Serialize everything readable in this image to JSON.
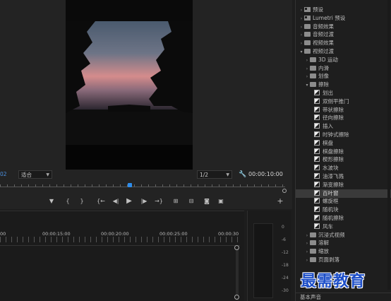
{
  "monitor": {
    "timecode_left": "02",
    "fit": "适合",
    "resolution": "1/2",
    "timecode_right": "00:00:10:00"
  },
  "transport": {
    "marker": "▼",
    "in": "{",
    "out": "}",
    "go_in": "{←",
    "step_back": "◀|",
    "play": "▶",
    "step_fwd": "|▶",
    "go_out": "→}",
    "add": "+"
  },
  "timeline": {
    "labels": [
      "00",
      "00:00:15:00",
      "00:00:20:00",
      "00:00:25:00",
      "00:00:30"
    ]
  },
  "meter": {
    "db_labels": [
      "0",
      "-6",
      "-12",
      "-18",
      "-24",
      "-30"
    ]
  },
  "effects": {
    "rows": [
      {
        "label": "预设",
        "kind": "folder",
        "chev": "›",
        "indent": 0
      },
      {
        "label": "Lumetri 预设",
        "kind": "folder",
        "chev": "›",
        "indent": 0
      },
      {
        "label": "音频效果",
        "kind": "folder",
        "chev": "›",
        "indent": 0
      },
      {
        "label": "音频过渡",
        "kind": "folder",
        "chev": "›",
        "indent": 0
      },
      {
        "label": "视频效果",
        "kind": "folder",
        "chev": "›",
        "indent": 0
      },
      {
        "label": "视频过渡",
        "kind": "folder",
        "chev": "⌄",
        "indent": 0
      },
      {
        "label": "3D 运动",
        "kind": "folder",
        "chev": "›",
        "indent": 1
      },
      {
        "label": "内滑",
        "kind": "folder",
        "chev": "›",
        "indent": 1
      },
      {
        "label": "划像",
        "kind": "folder",
        "chev": "›",
        "indent": 1
      },
      {
        "label": "擦除",
        "kind": "folder",
        "chev": "⌄",
        "indent": 1
      },
      {
        "label": "划出",
        "kind": "fx",
        "indent": 2
      },
      {
        "label": "双侧平推门",
        "kind": "fx",
        "indent": 2
      },
      {
        "label": "带状擦除",
        "kind": "fx",
        "indent": 2
      },
      {
        "label": "径向擦除",
        "kind": "fx",
        "indent": 2
      },
      {
        "label": "插入",
        "kind": "fx",
        "indent": 2
      },
      {
        "label": "时钟式擦除",
        "kind": "fx",
        "indent": 2
      },
      {
        "label": "棋盘",
        "kind": "fx",
        "indent": 2
      },
      {
        "label": "棋盘擦除",
        "kind": "fx",
        "indent": 2
      },
      {
        "label": "楔形擦除",
        "kind": "fx",
        "indent": 2
      },
      {
        "label": "水波块",
        "kind": "fx",
        "indent": 2
      },
      {
        "label": "油漆飞溅",
        "kind": "fx",
        "indent": 2
      },
      {
        "label": "渐变擦除",
        "kind": "fx",
        "indent": 2
      },
      {
        "label": "百叶窗",
        "kind": "fx",
        "indent": 2,
        "selected": true
      },
      {
        "label": "螺旋框",
        "kind": "fx",
        "indent": 2
      },
      {
        "label": "随机块",
        "kind": "fx",
        "indent": 2
      },
      {
        "label": "随机擦除",
        "kind": "fx",
        "indent": 2
      },
      {
        "label": "风车",
        "kind": "fx",
        "indent": 2
      },
      {
        "label": "沉浸式视频",
        "kind": "folder",
        "chev": "›",
        "indent": 1
      },
      {
        "label": "溶解",
        "kind": "folder",
        "chev": "›",
        "indent": 1
      },
      {
        "label": "缩放",
        "kind": "folder",
        "chev": "›",
        "indent": 1
      },
      {
        "label": "页面剥落",
        "kind": "folder",
        "chev": "›",
        "indent": 1
      }
    ],
    "bottom_panel": "基本声音"
  },
  "watermark": "最需教育",
  "colors": {
    "accent": "#2d8ceb",
    "timecode": "#4a8fe0",
    "watermark": "#1e4fc8"
  }
}
